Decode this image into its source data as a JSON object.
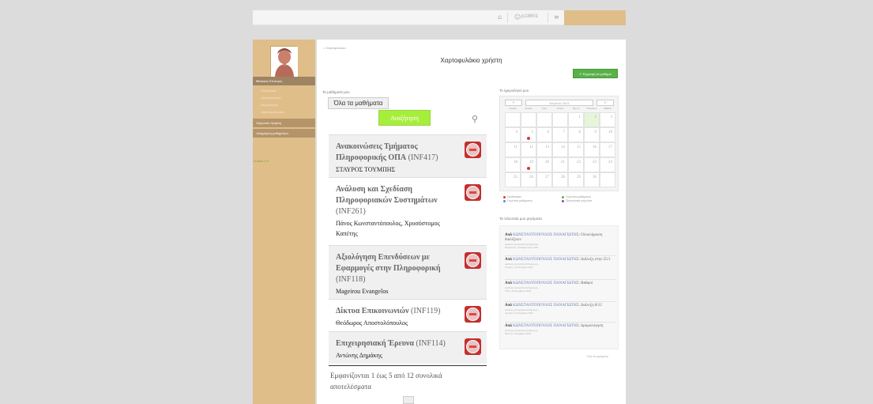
{
  "header": {
    "home_icon": "home-icon",
    "user_name": "js18601",
    "user_icon": "user-icon",
    "menu_icon": "hamburger-icon"
  },
  "sidebar": {
    "menu": [
      {
        "label": "Βασικές Επιλογές",
        "type": "head"
      },
      {
        "label": "Μηνύματα",
        "type": "sub"
      },
      {
        "label": "Ανακοινώσεις",
        "type": "sub"
      },
      {
        "label": "Ημερολόγιο",
        "type": "sub"
      },
      {
        "label": "Αγαπημένα μου",
        "type": "sub"
      },
      {
        "label": "Εργαλεία Χρήστη",
        "type": "head2"
      },
      {
        "label": "Διαχείριση μαθημάτων",
        "type": "head2"
      }
    ],
    "version": "eClass 3.9"
  },
  "main": {
    "breadcrumb": "Χαρτοφυλάκιο",
    "title": "Χαρτοφυλάκιο χρήστη",
    "add_course_label": "✔ Εγγραφή σε μάθημα",
    "courses_section_title": "Τα μαθήματά μου",
    "all_courses_label": "Όλα τα μαθήματα",
    "search_label": "Αναζήτηση",
    "courses": [
      {
        "name": "Ανακοινώσεις Τμήματος Πληροφορικής ΟΠΑ",
        "code": "(INF417)",
        "teacher": "ΣΤΑΥΡΟΣ ΤΟΥΜΠΗΣ"
      },
      {
        "name": "Ανάλυση και Σχεδίαση Πληροφοριακών Συστημάτων",
        "code": "(INF261)",
        "teacher": "Πάνος Κωνσταντόπουλος, Χρυσόστομος Καπέτης"
      },
      {
        "name": "Αξιολόγηση Επενδύσεων με Εφαρμογές στην Πληροφορική",
        "code": "(INF118)",
        "teacher": "Mageirou Evangelos"
      },
      {
        "name": "Δίκτυα Επικοινωνιών",
        "code": "(INF119)",
        "teacher": "Θεόδωρος Αποστολόπουλος"
      },
      {
        "name": "Επιχειρησιακή Έρευνα",
        "code": "(INF114)",
        "teacher": "Αντώνης Δημάκης"
      }
    ],
    "results_text": "Εμφανίζονται 1 έως 5 από 12 συνολικά αποτελέσματα"
  },
  "calendar": {
    "section_title": "Το ημερολόγιό μου",
    "month_label": "Απρίλιος 2021",
    "prev_label": "‹",
    "next_label": "›",
    "weekdays": [
      "Κυριακή",
      "Δευτέρα",
      "Τρίτη",
      "Τετάρτη",
      "Πέμπτη",
      "Παρασκευή",
      "Σάββατο"
    ],
    "weeks": [
      [
        "",
        "",
        "",
        "",
        "1",
        "2",
        "3"
      ],
      [
        "4",
        "5",
        "6",
        "7",
        "8",
        "9",
        "10"
      ],
      [
        "11",
        "12",
        "13",
        "14",
        "15",
        "16",
        "17"
      ],
      [
        "18",
        "19",
        "20",
        "21",
        "22",
        "23",
        "24"
      ],
      [
        "25",
        "26",
        "27",
        "28",
        "29",
        "30",
        ""
      ]
    ],
    "today": "2",
    "event_days": [
      "5",
      "19"
    ],
    "event_color": "#d23b3b",
    "legend": [
      {
        "label": "Προθεσμίες",
        "color": "#d23b3b"
      },
      {
        "label": "Γεγονότα μαθήματος",
        "color": "#5ab14a"
      },
      {
        "label": "Γεγονότα μαθήματος",
        "color": "#4a90d9"
      },
      {
        "label": "Προσωπικά γεγονότα",
        "color": "#8a4bb0"
      }
    ]
  },
  "messages": {
    "section_title": "Τα τελευταία μου μηνύματα",
    "items": [
      {
        "from_prefix": "Από",
        "from": "ΚΩΝΣΤΑΝΤΟΠΟΥΛΟΣ ΠΑΝΑΓΙΩΤΗΣ",
        "subject": "Ολοκλήρωση διαλέξεων",
        "course": "Ανάλυση και Σχεδίαση Πληροφορ...",
        "date": "Παρασκευή, 19 Φεβρουαρίου 2021"
      },
      {
        "from_prefix": "Από",
        "from": "ΚΩΝΣΤΑΝΤΟΠΟΥΛΟΣ ΠΑΝΑΓΙΩΤΗΣ",
        "subject": "Διάλεξη στην 25/1",
        "course": "Ανάλυση και Σχεδίαση Πληροφορ...",
        "date": "Τετάρτη, 13 Ιανουαρίου 2021"
      },
      {
        "from_prefix": "Από",
        "from": "ΚΩΝΣΤΑΝΤΟΠΟΥΛΟΣ ΠΑΝΑΓΙΩΤΗΣ",
        "subject": "Βαθμοί",
        "course": "Ανάλυση και Σχεδίαση Πληροφορ...",
        "date": "Τρίτη, 29 Δεκεμβρίου 2020"
      },
      {
        "from_prefix": "Από",
        "from": "ΚΩΝΣΤΑΝΤΟΠΟΥΛΟΣ ΠΑΝΑΓΙΩΤΗΣ",
        "subject": "Διάλεξη 8/12",
        "course": "Ανάλυση και Σχεδίαση Πληροφορ...",
        "date": "Δευτέρα, 23 Νοεμβρίου 2020"
      },
      {
        "from_prefix": "Από",
        "from": "ΚΩΝΣΤΑΝΤΟΠΟΥΛΟΣ ΠΑΝΑΓΙΩΤΗΣ",
        "subject": "Δρομολόγηση",
        "course": "Ανάλυση και Σχεδίαση Πληροφορ...",
        "date": "Πέμπτη, 5 Νοεμβρίου 2020"
      }
    ],
    "all_label": "Όλα τα μηνύματα"
  }
}
